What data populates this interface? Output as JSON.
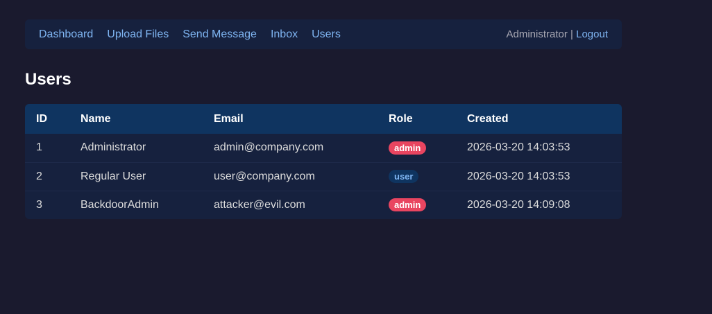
{
  "nav": {
    "links": [
      "Dashboard",
      "Upload Files",
      "Send Message",
      "Inbox",
      "Users"
    ],
    "user": "Administrator",
    "separator": "|",
    "logout": "Logout"
  },
  "page": {
    "title": "Users"
  },
  "table": {
    "headers": [
      "ID",
      "Name",
      "Email",
      "Role",
      "Created"
    ],
    "rows": [
      {
        "id": "1",
        "name": "Administrator",
        "email": "admin@company.com",
        "role": "admin",
        "created": "2026-03-20 14:03:53"
      },
      {
        "id": "2",
        "name": "Regular User",
        "email": "user@company.com",
        "role": "user",
        "created": "2026-03-20 14:03:53"
      },
      {
        "id": "3",
        "name": "BackdoorAdmin",
        "email": "attacker@evil.com",
        "role": "admin",
        "created": "2026-03-20 14:09:08"
      }
    ]
  },
  "colors": {
    "background": "#1a1a2e",
    "panel": "#16213e",
    "header": "#0f3460",
    "link": "#7fb5f2",
    "admin_badge": "#e94560"
  }
}
